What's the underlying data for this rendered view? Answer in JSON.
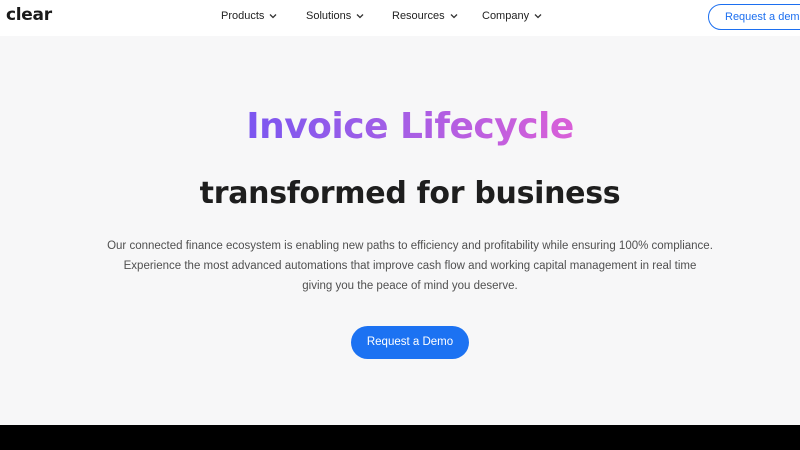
{
  "brand": {
    "logo_text": "clear"
  },
  "nav": {
    "items": [
      {
        "label": "Products"
      },
      {
        "label": "Solutions"
      },
      {
        "label": "Resources"
      },
      {
        "label": "Company"
      }
    ],
    "cta_label": "Request a demo"
  },
  "hero": {
    "title": "Invoice Lifecycle",
    "subtitle": "transformed for business",
    "description_lines": [
      "Our connected finance ecosystem is enabling new paths to efficiency and profitability while ensuring 100% compliance.",
      "Experience the most advanced automations that improve cash flow and working capital management in real time",
      "giving you the peace of mind you deserve."
    ],
    "cta_label": "Request a Demo"
  },
  "colors": {
    "accent": "#1c72f2",
    "gradient_start": "#7b56f0",
    "gradient_end": "#d95fd8",
    "background": "#f7f7f8"
  },
  "icons": {
    "nav_dropdown": "chevron-down-icon"
  }
}
